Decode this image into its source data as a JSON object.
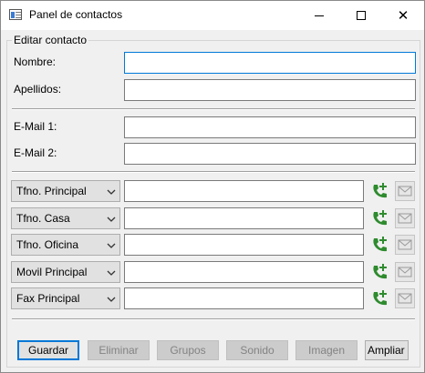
{
  "window": {
    "title": "Panel de contactos"
  },
  "group": {
    "label": "Editar contacto"
  },
  "fields": {
    "nombre": {
      "label": "Nombre:",
      "value": ""
    },
    "apellidos": {
      "label": "Apellidos:",
      "value": ""
    },
    "email1": {
      "label": "E-Mail 1:",
      "value": ""
    },
    "email2": {
      "label": "E-Mail 2:",
      "value": ""
    }
  },
  "phones": [
    {
      "type": "Tfno. Principal",
      "value": ""
    },
    {
      "type": "Tfno. Casa",
      "value": ""
    },
    {
      "type": "Tfno. Oficina",
      "value": ""
    },
    {
      "type": "Movil Principal",
      "value": ""
    },
    {
      "type": "Fax Principal",
      "value": ""
    }
  ],
  "buttons": {
    "guardar": "Guardar",
    "eliminar": "Eliminar",
    "grupos": "Grupos",
    "sonido": "Sonido",
    "imagen": "Imagen",
    "ampliar": "Ampliar ›"
  },
  "icons": {
    "app": "contacts-window-icon",
    "minimize": "minimize-icon",
    "maximize": "maximize-icon",
    "close": "close-icon",
    "call": "phone-add-icon",
    "mail": "envelope-icon",
    "chevron": "chevron-down-icon"
  },
  "colors": {
    "accent": "#0078d7",
    "phone_green": "#2e8b2e",
    "disabled_text": "#838383"
  }
}
